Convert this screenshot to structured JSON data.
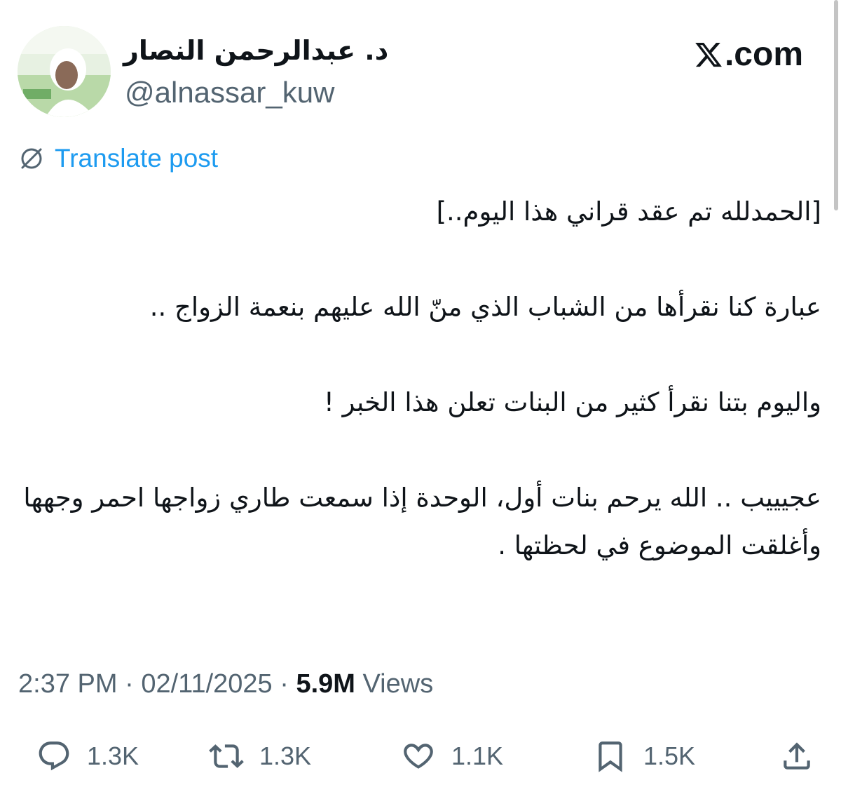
{
  "author": {
    "display_name": "د. عبدالرحمن النصار",
    "handle": "@alnassar_kuw"
  },
  "brand": {
    "label": ".com",
    "icon": "x-logo-icon"
  },
  "translate": {
    "label": "Translate post",
    "icon": "globe-slash-icon"
  },
  "post": {
    "paragraphs": [
      "[الحمدلله تم عقد قراني هذا اليوم..]",
      "عبارة كنا نقرأها من الشباب الذي منّ الله عليهم بنعمة الزواج ..",
      "واليوم بتنا نقرأ كثير من البنات تعلن هذا الخبر !",
      "عجيييب .. الله يرحم بنات أول، الوحدة إذا سمعت طاري زواجها احمر وجهها وأغلقت الموضوع في لحظتها ."
    ]
  },
  "meta": {
    "time": "2:37 PM",
    "separator": " · ",
    "date": "02/11/2025",
    "views_count": "5.9M",
    "views_label": " Views"
  },
  "actions": {
    "replies": "1.3K",
    "reposts": "1.3K",
    "likes": "1.1K",
    "bookmarks": "1.5K"
  },
  "colors": {
    "link": "#1d9bf0",
    "muted": "#536471",
    "text": "#0f1419"
  }
}
